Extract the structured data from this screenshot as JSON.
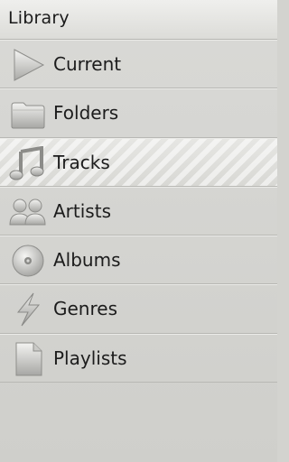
{
  "header": {
    "title": "Library"
  },
  "menu": {
    "items": [
      {
        "label": "Current",
        "icon": "play-icon"
      },
      {
        "label": "Folders",
        "icon": "folder-icon"
      },
      {
        "label": "Tracks",
        "icon": "music-note-icon",
        "selected": true
      },
      {
        "label": "Artists",
        "icon": "people-icon"
      },
      {
        "label": "Albums",
        "icon": "disc-icon"
      },
      {
        "label": "Genres",
        "icon": "lightning-icon"
      },
      {
        "label": "Playlists",
        "icon": "document-icon"
      }
    ]
  }
}
